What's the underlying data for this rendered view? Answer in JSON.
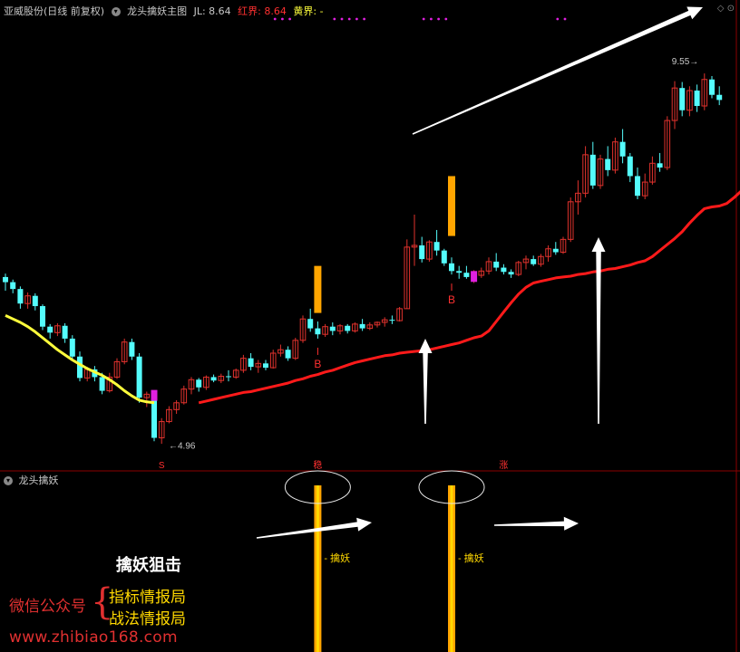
{
  "header": {
    "stock": "亚威股份(日线 前复权)",
    "indicator": "龙头擒妖主图",
    "jl_label": "JL: 8.64",
    "red_label": "红界: 8.64",
    "yellow_label": "黄界: -"
  },
  "sub_header": {
    "indicator": "龙头擒妖"
  },
  "colors": {
    "up": "#e0322d",
    "down": "#54fcfc",
    "ma_red": "#ff1a1a",
    "ma_yellow": "#ffff3c",
    "magenta": "#e020e0",
    "signal_orange": "#ffa500",
    "signal_yellow": "#ffd800",
    "grid": "#8b0000"
  },
  "chart_data": {
    "type": "candlestick",
    "candles": [
      [
        6.67,
        6.71,
        6.51,
        6.61
      ],
      [
        6.61,
        6.64,
        6.48,
        6.53
      ],
      [
        6.53,
        6.56,
        6.3,
        6.36
      ],
      [
        6.36,
        6.49,
        6.3,
        6.45
      ],
      [
        6.45,
        6.48,
        6.28,
        6.33
      ],
      [
        6.33,
        6.35,
        6.05,
        6.09
      ],
      [
        6.09,
        6.12,
        5.95,
        6.02
      ],
      [
        6.02,
        6.13,
        5.98,
        6.1
      ],
      [
        6.1,
        6.13,
        5.9,
        5.95
      ],
      [
        5.95,
        5.99,
        5.7,
        5.74
      ],
      [
        5.74,
        5.8,
        5.45,
        5.49
      ],
      [
        5.49,
        5.62,
        5.45,
        5.59
      ],
      [
        5.59,
        5.63,
        5.45,
        5.5
      ],
      [
        5.5,
        5.55,
        5.3,
        5.34
      ],
      [
        5.34,
        5.55,
        5.32,
        5.5
      ],
      [
        5.5,
        5.72,
        5.48,
        5.68
      ],
      [
        5.68,
        5.95,
        5.65,
        5.91
      ],
      [
        5.91,
        5.95,
        5.7,
        5.74
      ],
      [
        5.74,
        5.78,
        5.2,
        5.26
      ],
      [
        5.26,
        5.33,
        5.15,
        5.3
      ],
      [
        5.3,
        5.32,
        4.75,
        4.79
      ],
      [
        4.79,
        5.02,
        4.72,
        4.98
      ],
      [
        4.98,
        5.16,
        4.96,
        5.12
      ],
      [
        5.12,
        5.23,
        5.07,
        5.2
      ],
      [
        5.2,
        5.4,
        5.18,
        5.36
      ],
      [
        5.36,
        5.5,
        5.3,
        5.47
      ],
      [
        5.47,
        5.49,
        5.33,
        5.38
      ],
      [
        5.38,
        5.52,
        5.35,
        5.5
      ],
      [
        5.5,
        5.53,
        5.44,
        5.46
      ],
      [
        5.46,
        5.54,
        5.43,
        5.51
      ],
      [
        5.51,
        5.58,
        5.45,
        5.5
      ],
      [
        5.5,
        5.6,
        5.48,
        5.58
      ],
      [
        5.58,
        5.76,
        5.55,
        5.72
      ],
      [
        5.72,
        5.78,
        5.58,
        5.62
      ],
      [
        5.62,
        5.7,
        5.55,
        5.66
      ],
      [
        5.66,
        5.7,
        5.58,
        5.61
      ],
      [
        5.61,
        5.82,
        5.6,
        5.78
      ],
      [
        5.78,
        5.88,
        5.74,
        5.82
      ],
      [
        5.82,
        5.86,
        5.69,
        5.72
      ],
      [
        5.72,
        5.96,
        5.7,
        5.93
      ],
      [
        5.93,
        6.22,
        5.9,
        6.18
      ],
      [
        6.18,
        6.3,
        6.03,
        6.07
      ],
      [
        6.07,
        6.15,
        5.95,
        6.0
      ],
      [
        6.0,
        6.12,
        5.97,
        6.09
      ],
      [
        6.09,
        6.14,
        5.99,
        6.04
      ],
      [
        6.04,
        6.12,
        6.0,
        6.1
      ],
      [
        6.1,
        6.12,
        6.01,
        6.04
      ],
      [
        6.04,
        6.14,
        6.02,
        6.12
      ],
      [
        6.12,
        6.18,
        6.04,
        6.07
      ],
      [
        6.07,
        6.14,
        6.05,
        6.11
      ],
      [
        6.11,
        6.15,
        6.08,
        6.14
      ],
      [
        6.14,
        6.2,
        6.09,
        6.17
      ],
      [
        6.17,
        6.22,
        6.12,
        6.16
      ],
      [
        6.16,
        6.32,
        6.15,
        6.3
      ],
      [
        6.3,
        7.11,
        6.3,
        7.02
      ],
      [
        7.02,
        7.4,
        6.8,
        7.04
      ],
      [
        7.04,
        7.14,
        6.84,
        6.88
      ],
      [
        6.88,
        7.1,
        6.85,
        7.08
      ],
      [
        7.08,
        7.22,
        6.92,
        6.98
      ],
      [
        6.98,
        7.0,
        6.8,
        6.83
      ],
      [
        6.83,
        6.9,
        6.7,
        6.74
      ],
      [
        6.74,
        6.8,
        6.65,
        6.72
      ],
      [
        6.72,
        6.8,
        6.65,
        6.67
      ],
      [
        6.67,
        6.75,
        6.6,
        6.69
      ],
      [
        6.69,
        6.78,
        6.66,
        6.74
      ],
      [
        6.74,
        6.9,
        6.7,
        6.85
      ],
      [
        6.85,
        6.95,
        6.74,
        6.78
      ],
      [
        6.78,
        6.82,
        6.7,
        6.73
      ],
      [
        6.73,
        6.76,
        6.66,
        6.7
      ],
      [
        6.7,
        6.86,
        6.68,
        6.84
      ],
      [
        6.84,
        6.92,
        6.76,
        6.88
      ],
      [
        6.88,
        6.92,
        6.8,
        6.82
      ],
      [
        6.82,
        6.94,
        6.79,
        6.91
      ],
      [
        6.91,
        7.04,
        6.85,
        7.0
      ],
      [
        7.0,
        7.08,
        6.93,
        6.96
      ],
      [
        6.96,
        7.14,
        6.94,
        7.11
      ],
      [
        7.11,
        7.6,
        7.08,
        7.55
      ],
      [
        7.55,
        7.8,
        7.4,
        7.65
      ],
      [
        7.65,
        8.2,
        7.6,
        8.1
      ],
      [
        8.1,
        8.25,
        7.7,
        7.74
      ],
      [
        7.74,
        8.1,
        7.7,
        8.05
      ],
      [
        8.05,
        8.2,
        7.85,
        7.92
      ],
      [
        7.92,
        8.3,
        7.88,
        8.25
      ],
      [
        8.25,
        8.4,
        8.0,
        8.08
      ],
      [
        8.08,
        8.12,
        7.78,
        7.85
      ],
      [
        7.85,
        7.95,
        7.58,
        7.62
      ],
      [
        7.62,
        7.88,
        7.58,
        7.78
      ],
      [
        7.78,
        8.08,
        7.75,
        8.0
      ],
      [
        8.0,
        8.12,
        7.9,
        7.95
      ],
      [
        7.95,
        8.55,
        7.92,
        8.5
      ],
      [
        8.5,
        8.96,
        8.4,
        8.88
      ],
      [
        8.88,
        8.95,
        8.55,
        8.62
      ],
      [
        8.62,
        8.9,
        8.55,
        8.85
      ],
      [
        8.85,
        8.92,
        8.6,
        8.67
      ],
      [
        8.67,
        9.05,
        8.62,
        8.98
      ],
      [
        8.98,
        9.02,
        8.76,
        8.8
      ],
      [
        8.8,
        8.9,
        8.68,
        8.74
      ]
    ],
    "red_line": [
      5.2,
      5.22,
      5.24,
      5.26,
      5.28,
      5.3,
      5.32,
      5.33,
      5.35,
      5.37,
      5.39,
      5.41,
      5.43,
      5.46,
      5.48,
      5.51,
      5.53,
      5.56,
      5.58,
      5.61,
      5.64,
      5.67,
      5.69,
      5.71,
      5.73,
      5.75,
      5.76,
      5.78,
      5.79,
      5.8,
      5.81,
      5.82,
      5.84,
      5.86,
      5.88,
      5.9,
      5.93,
      5.96,
      5.98,
      6.04,
      6.15,
      6.26,
      6.37,
      6.47,
      6.55,
      6.6,
      6.62,
      6.64,
      6.66,
      6.67,
      6.68,
      6.7,
      6.71,
      6.73,
      6.74,
      6.76,
      6.77,
      6.79,
      6.81,
      6.84,
      6.86,
      6.91,
      6.98,
      7.05,
      7.12,
      7.2,
      7.3,
      7.39,
      7.47,
      7.49,
      7.5,
      7.53,
      7.6,
      7.68,
      7.75,
      7.82,
      7.88,
      7.95,
      8.01,
      8.07,
      8.14,
      8.2,
      8.27,
      8.32,
      8.37
    ],
    "yellow_line": [
      6.22,
      6.18,
      6.14,
      6.09,
      6.03,
      5.96,
      5.89,
      5.82,
      5.76,
      5.7,
      5.65,
      5.6,
      5.56,
      5.52,
      5.47,
      5.41,
      5.34,
      5.28,
      5.23,
      5.21,
      5.2
    ],
    "magenta_bars": [
      20,
      63
    ],
    "signals": [
      {
        "index": 42,
        "label": "B"
      },
      {
        "index": 60,
        "label": "B"
      }
    ],
    "orange_bars": [
      [
        42,
        6.25,
        6.8
      ],
      [
        60,
        7.15,
        7.85
      ]
    ],
    "annotations": {
      "low": "4.96",
      "high": "9.55"
    },
    "markers": [
      {
        "index": 21,
        "label": "S"
      },
      {
        "index": 42,
        "label": "稳"
      },
      {
        "index": 67,
        "label": "涨"
      }
    ],
    "sub": {
      "signals": [
        {
          "index": 42,
          "label": "擒妖"
        },
        {
          "index": 60,
          "label": "擒妖"
        }
      ]
    }
  },
  "promo": {
    "title": "擒妖狙击",
    "wechat": "微信公众号",
    "line1": "指标情报局",
    "line2": "战法情报局",
    "url": "www.zhibiao168.com"
  }
}
